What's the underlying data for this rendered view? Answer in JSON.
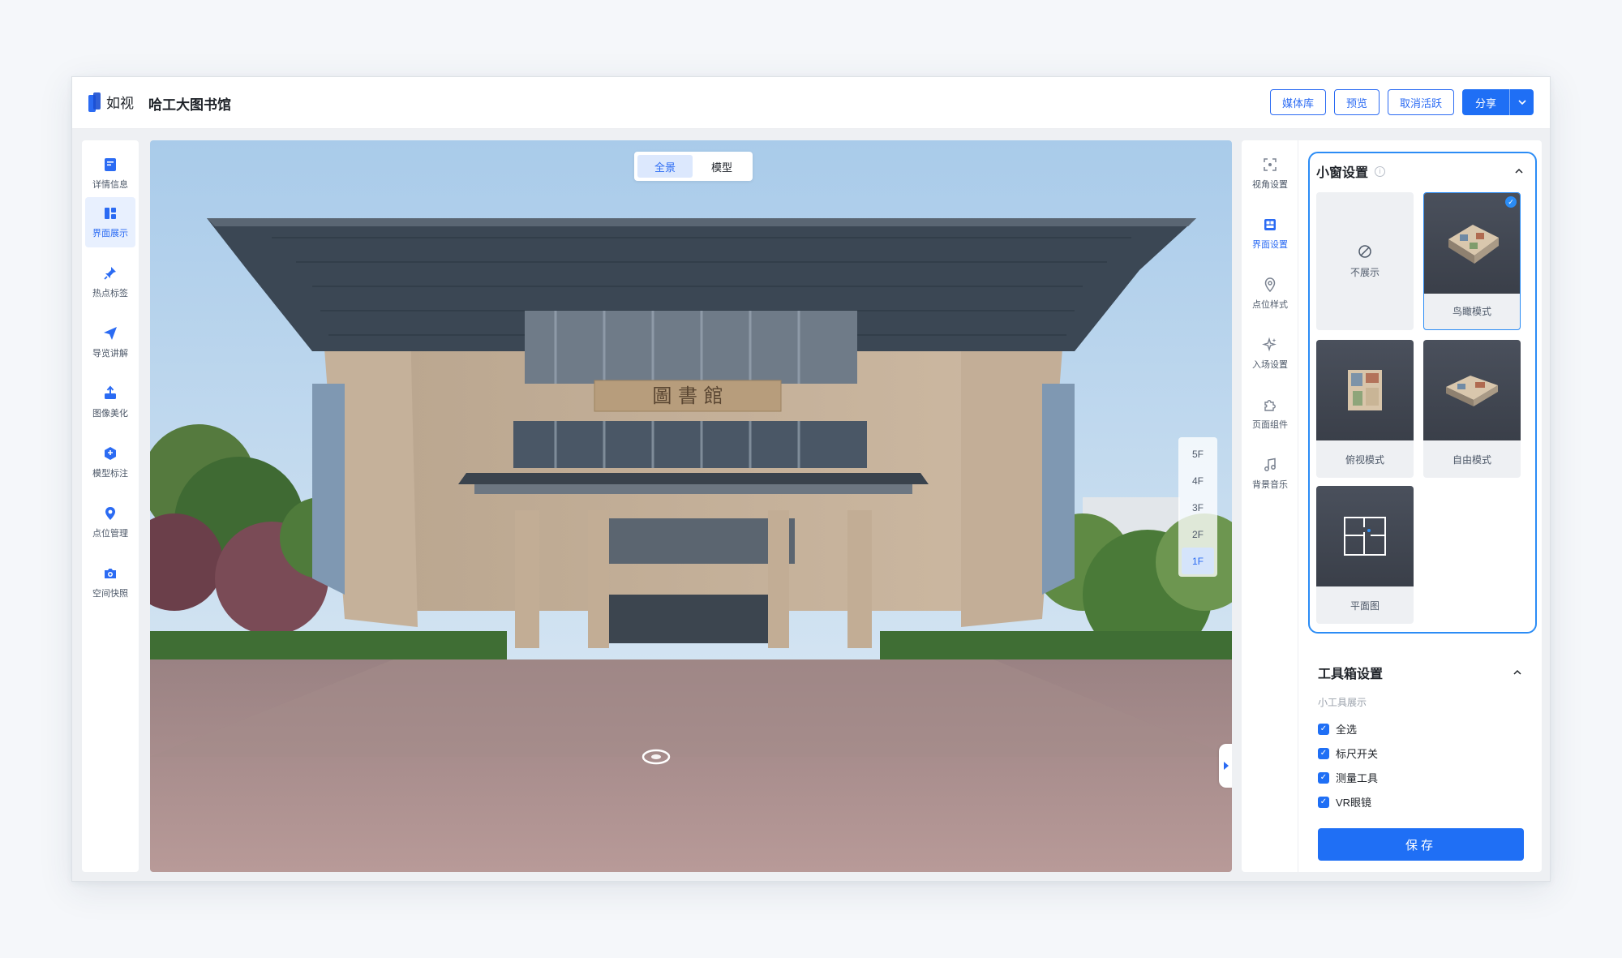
{
  "brand": {
    "logo_text": "如视"
  },
  "header": {
    "title": "哈工大图书馆",
    "media_label": "媒体库",
    "preview_label": "预览",
    "deactivate_label": "取消活跃",
    "share_label": "分享"
  },
  "left_nav": {
    "items": [
      {
        "label": "详情信息",
        "icon": "detail-info-icon"
      },
      {
        "label": "界面展示",
        "icon": "ui-display-icon",
        "active": true
      },
      {
        "label": "热点标签",
        "icon": "hotspot-pin-icon"
      },
      {
        "label": "导览讲解",
        "icon": "tour-send-icon"
      },
      {
        "label": "图像美化",
        "icon": "image-enhance-icon"
      },
      {
        "label": "模型标注",
        "icon": "model-annotate-icon"
      },
      {
        "label": "点位管理",
        "icon": "location-pin-icon"
      },
      {
        "label": "空间快照",
        "icon": "camera-snapshot-icon"
      }
    ]
  },
  "viewer": {
    "tabs": [
      {
        "label": "全景",
        "active": true
      },
      {
        "label": "模型"
      }
    ],
    "building_sign": "圖 書 館",
    "floors": [
      "5F",
      "4F",
      "3F",
      "2F",
      "1F"
    ],
    "active_floor": "1F"
  },
  "right_rail": {
    "items": [
      {
        "label": "视角设置",
        "icon": "viewpoint-icon"
      },
      {
        "label": "界面设置",
        "icon": "ui-settings-icon",
        "active": true
      },
      {
        "label": "点位样式",
        "icon": "location-style-icon"
      },
      {
        "label": "入场设置",
        "icon": "entrance-sparkle-icon"
      },
      {
        "label": "页面组件",
        "icon": "puzzle-piece-icon"
      },
      {
        "label": "背景音乐",
        "icon": "music-note-icon"
      }
    ]
  },
  "mini_window": {
    "title": "小窗设置",
    "options": [
      {
        "label": "不展示"
      },
      {
        "label": "鸟瞰模式",
        "selected": true
      },
      {
        "label": "俯视模式"
      },
      {
        "label": "自由模式"
      },
      {
        "label": "平面图"
      }
    ]
  },
  "toolbox": {
    "title": "工具箱设置",
    "sub_label": "小工具展示",
    "checks": [
      {
        "label": "全选",
        "checked": true
      },
      {
        "label": "标尺开关",
        "checked": true
      },
      {
        "label": "测量工具",
        "checked": true
      },
      {
        "label": "VR眼镜",
        "checked": true
      }
    ]
  },
  "save_label": "保存",
  "colors": {
    "accent": "#1f6ff5",
    "selected_border": "#2b8cf5",
    "active_bg": "#e8f0fe"
  }
}
